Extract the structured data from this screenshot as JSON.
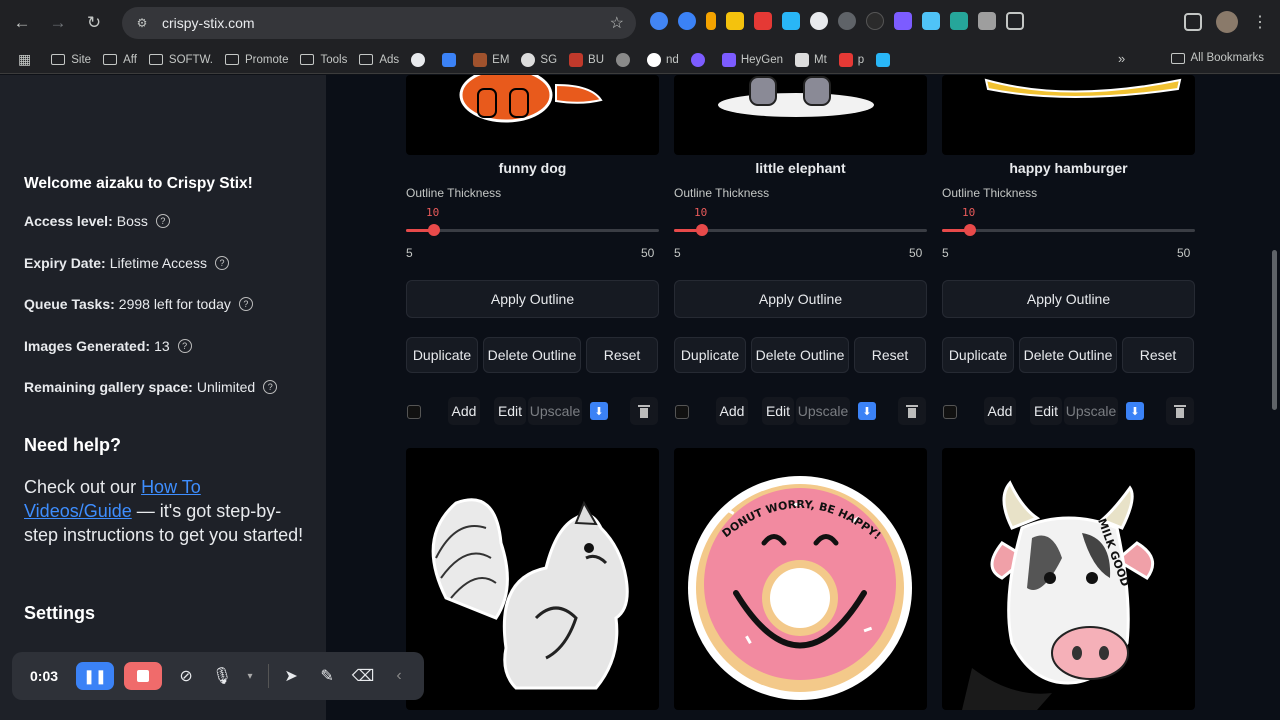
{
  "browser": {
    "url": "crispy-stix.com",
    "bookmarks": [
      {
        "label": "Site",
        "kind": "folder"
      },
      {
        "label": "Aff",
        "kind": "folder"
      },
      {
        "label": "SOFTW.",
        "kind": "folder"
      },
      {
        "label": "Promote",
        "kind": "folder"
      },
      {
        "label": "Tools",
        "kind": "folder"
      },
      {
        "label": "Ads",
        "kind": "folder"
      },
      {
        "label": "",
        "kind": "site",
        "color": "#e8eaed"
      },
      {
        "label": "",
        "kind": "site",
        "color": "#3b82f6"
      },
      {
        "label": "EM",
        "kind": "site",
        "color": "#a0522d"
      },
      {
        "label": "SG",
        "kind": "site",
        "color": "#dcdcdc"
      },
      {
        "label": "BU",
        "kind": "site",
        "color": "#c0392b"
      },
      {
        "label": "",
        "kind": "site",
        "color": "#8a8a8a"
      },
      {
        "label": "nd",
        "kind": "site",
        "color": "#ffffff"
      },
      {
        "label": "",
        "kind": "site",
        "color": "#7c5cff"
      },
      {
        "label": "HeyGen",
        "kind": "site",
        "color": "#7c5cff"
      },
      {
        "label": "Mt",
        "kind": "site",
        "color": "#dddddd"
      },
      {
        "label": "p",
        "kind": "site",
        "color": "#e53935"
      },
      {
        "label": "",
        "kind": "site",
        "color": "#29b6f6"
      }
    ],
    "all_bookmarks": "All Bookmarks"
  },
  "sidebar": {
    "welcome": "Welcome aizaku to Crispy Stix!",
    "access_level_label": "Access level:",
    "access_level_value": "Boss",
    "expiry_label": "Expiry Date:",
    "expiry_value": "Lifetime Access",
    "queue_label": "Queue Tasks:",
    "queue_value": "2998 left for today",
    "images_label": "Images Generated:",
    "images_value": "13",
    "gallery_label": "Remaining gallery space:",
    "gallery_value": "Unlimited",
    "need_help": "Need help?",
    "help_prefix": "Check out our ",
    "help_link": "How To Videos/Guide",
    "help_suffix": " — it's got step-by-step instructions to get you started!",
    "settings": "Settings"
  },
  "recorder": {
    "time": "0:03"
  },
  "cards": [
    {
      "title": "funny dog",
      "outline_label": "Outline Thickness",
      "value": 10,
      "min": 5,
      "max": 50,
      "min_label": "5",
      "max_label": "50",
      "value_label": "10",
      "apply": "Apply Outline",
      "duplicate": "Duplicate",
      "delete": "Delete Outline",
      "reset": "Reset",
      "add": "Add",
      "edit": "Edit",
      "upscale": "Upscale"
    },
    {
      "title": "little elephant",
      "outline_label": "Outline Thickness",
      "value": 10,
      "min": 5,
      "max": 50,
      "min_label": "5",
      "max_label": "50",
      "value_label": "10",
      "apply": "Apply Outline",
      "duplicate": "Duplicate",
      "delete": "Delete Outline",
      "reset": "Reset",
      "add": "Add",
      "edit": "Edit",
      "upscale": "Upscale"
    },
    {
      "title": "happy hamburger",
      "outline_label": "Outline Thickness",
      "value": 10,
      "min": 5,
      "max": 50,
      "min_label": "5",
      "max_label": "50",
      "value_label": "10",
      "apply": "Apply Outline",
      "duplicate": "Duplicate",
      "delete": "Delete Outline",
      "reset": "Reset",
      "add": "Add",
      "edit": "Edit",
      "upscale": "Upscale"
    }
  ],
  "gallery_row2": [
    {
      "image": "squirrel sticker"
    },
    {
      "image": "donut sticker",
      "text": "DONUT WORRY, BE HAPPY!"
    },
    {
      "image": "cow sticker",
      "text": "MILK GOOD"
    }
  ]
}
